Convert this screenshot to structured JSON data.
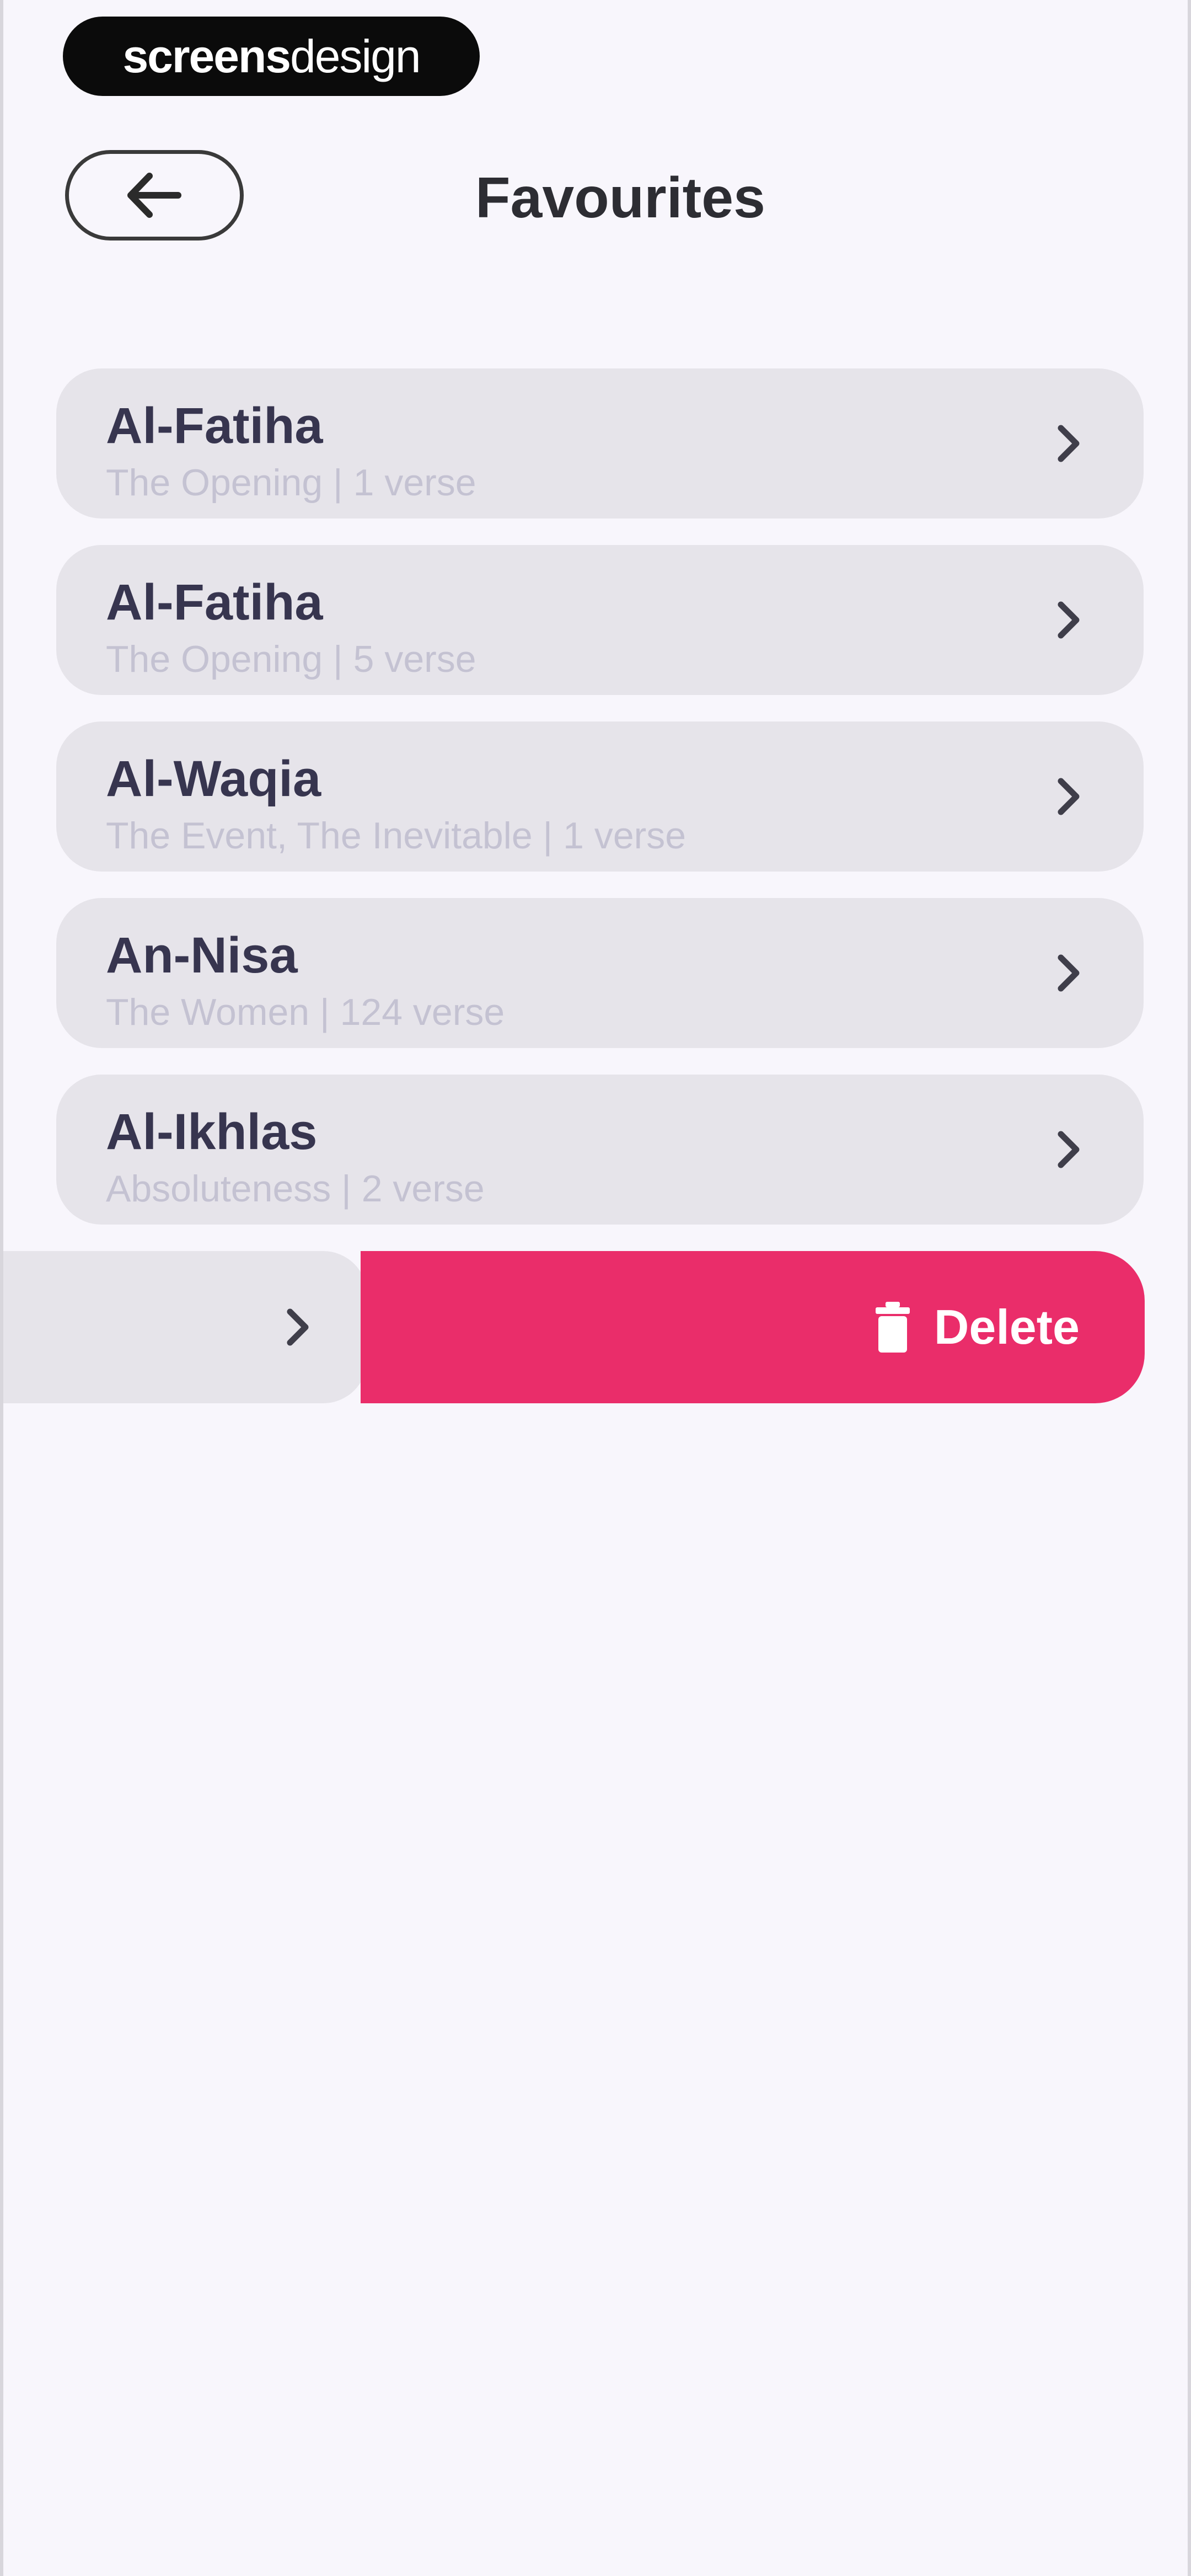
{
  "brand": {
    "part_a": "screens",
    "part_b": "design"
  },
  "header": {
    "title": "Favourites",
    "back_icon": "arrow-left-icon"
  },
  "favourites": [
    {
      "title": "Al-Fatiha",
      "subtitle": "The Opening | 1 verse"
    },
    {
      "title": "Al-Fatiha",
      "subtitle": "The Opening | 5 verse"
    },
    {
      "title": "Al-Waqia",
      "subtitle": "The Event, The Inevitable | 1 verse"
    },
    {
      "title": "An-Nisa",
      "subtitle": "The Women | 124 verse"
    },
    {
      "title": "Al-Ikhlas",
      "subtitle": "Absoluteness | 2 verse"
    }
  ],
  "swipe_actions": {
    "delete_label": "Delete",
    "delete_icon": "trash-icon",
    "delete_color": "#ea2d6a"
  },
  "colors": {
    "background": "#f8f6fc",
    "card": "#e6e4ea",
    "title_text": "#37354f",
    "subtitle_text": "#c4c2d2"
  }
}
